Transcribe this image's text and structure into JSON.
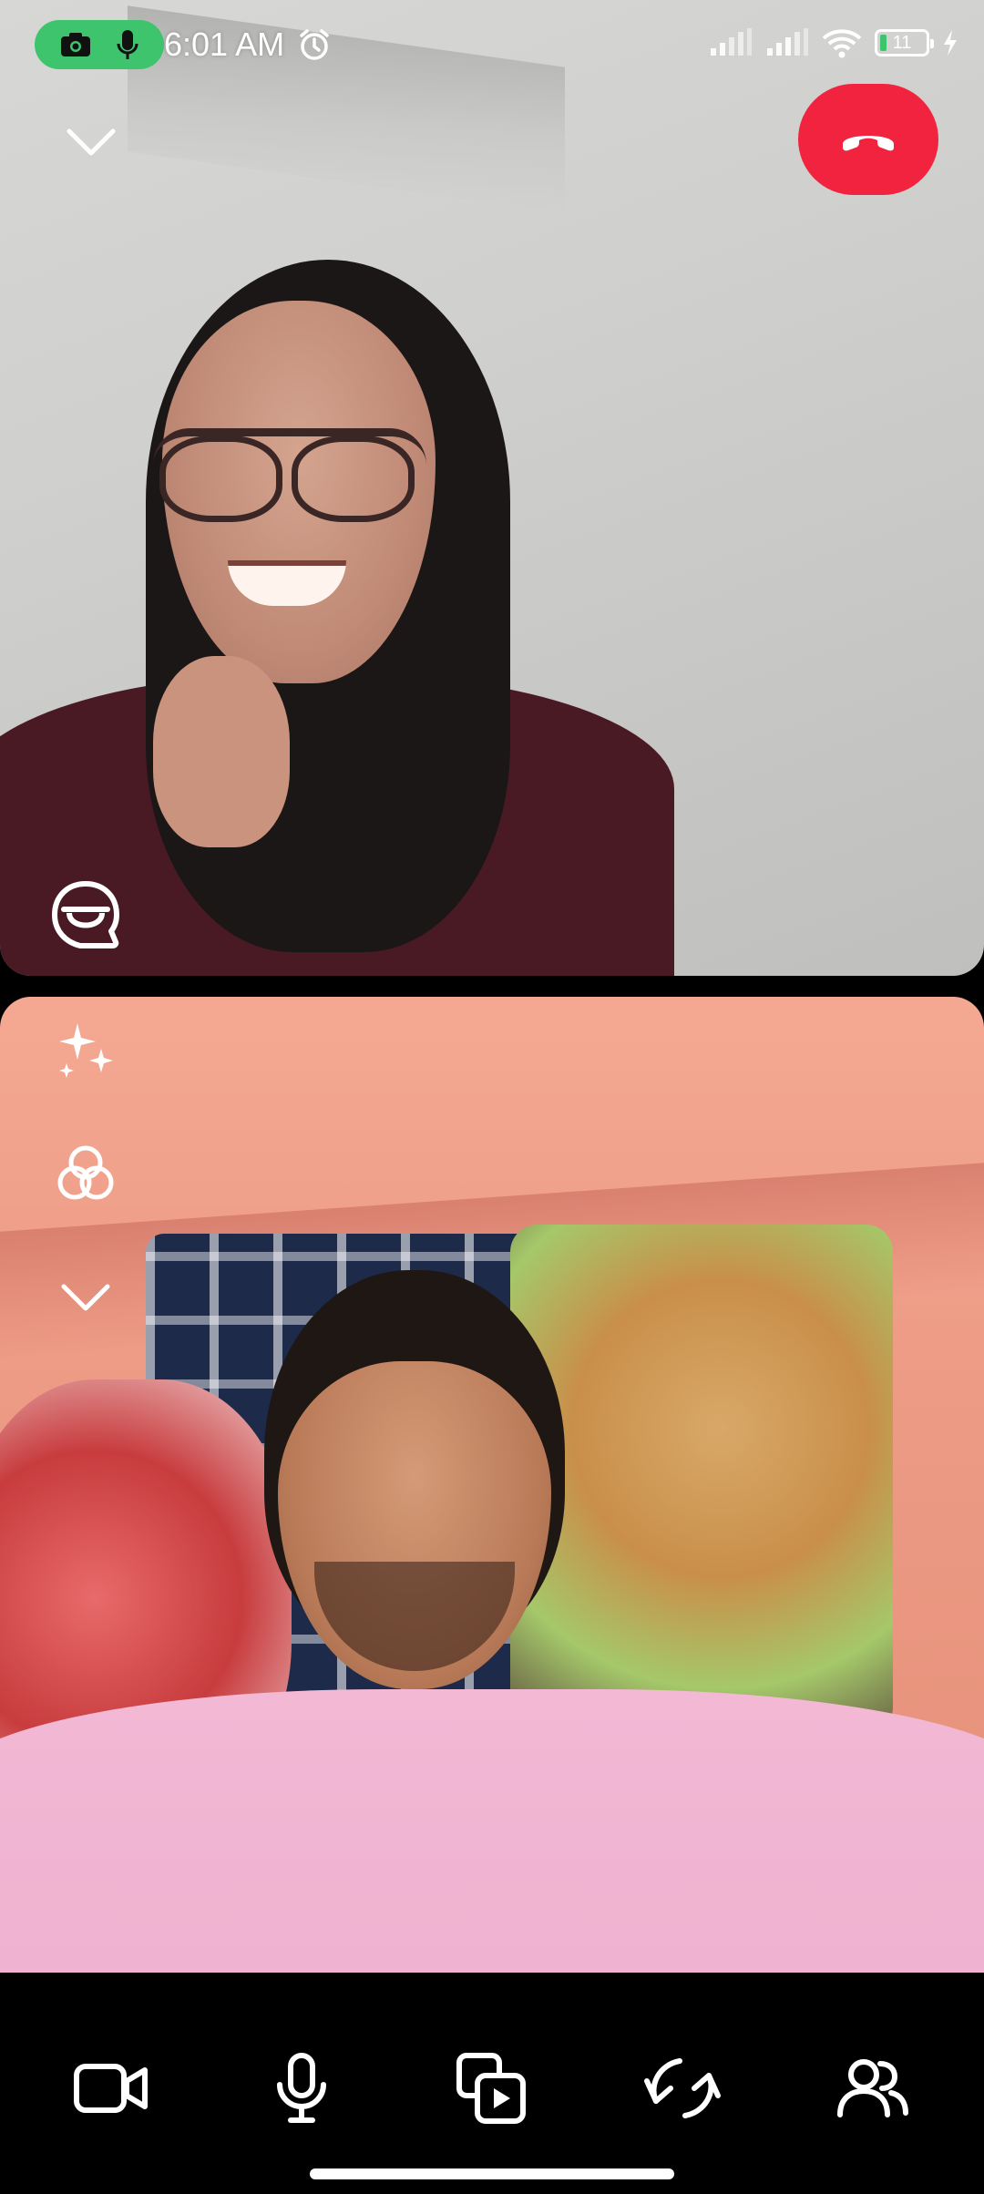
{
  "status_bar": {
    "time": "6:01 AM",
    "battery_level": "11",
    "icons": [
      "camera-in-use-icon",
      "mic-in-use-icon",
      "alarm-icon",
      "signal-icon",
      "signal-icon",
      "wifi-icon",
      "battery-icon",
      "charging-icon"
    ]
  },
  "call": {
    "top_tile": "remote-participant-video",
    "bottom_tile": "self-camera-preview",
    "top_controls": [
      "chevron-down-icon",
      "end-call-icon"
    ],
    "top_tile_controls": [
      "captions-icon"
    ],
    "side_tools": [
      "effects-sparkle-icon",
      "filters-icon",
      "chevron-down-icon"
    ],
    "bottom_controls": [
      "video-camera-icon",
      "microphone-icon",
      "share-media-icon",
      "flip-camera-icon",
      "participants-icon"
    ]
  },
  "colors": {
    "end_call": "#f2233f",
    "recording_pill": "#3ec46d",
    "background": "#000000"
  }
}
